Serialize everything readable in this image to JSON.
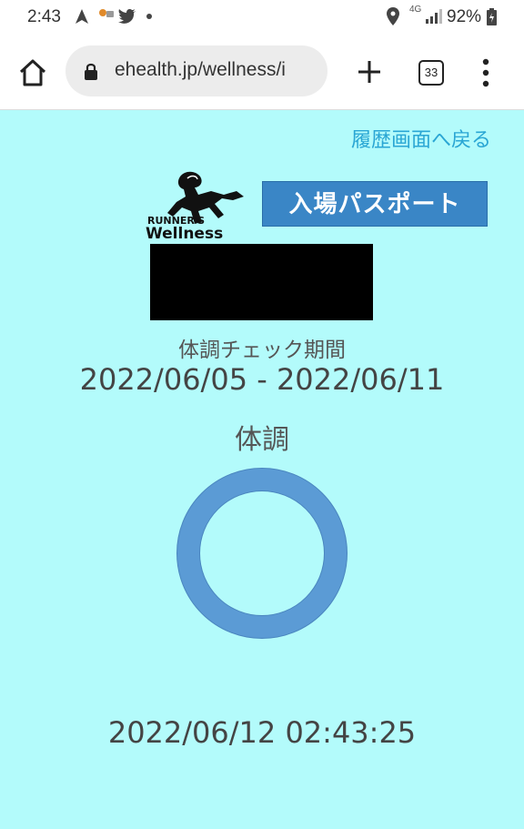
{
  "status_bar": {
    "time": "2:43",
    "network": "4G",
    "battery": "92%",
    "icons": [
      "navigation-icon",
      "notification-icon",
      "twitter-icon",
      "location-icon",
      "signal-icon",
      "battery-icon"
    ]
  },
  "browser": {
    "url": "ehealth.jp/wellness/i",
    "tab_count": "33"
  },
  "page": {
    "back_link": "履歴画面へ戻る",
    "logo": {
      "line1": "RUNNER'S",
      "line2": "Wellness"
    },
    "passport_label": "入場パスポート",
    "period_label": "体調チェック期間",
    "period_range": "2022/06/05 - 2022/06/11",
    "condition_label": "体調",
    "condition_mark": "circle",
    "timestamp": "2022/06/12 02:43:25"
  },
  "colors": {
    "background": "#b3fbfb",
    "link": "#2aa6d4",
    "badge": "#3a86c6",
    "ring": "#5b9bd5",
    "redaction": "#000000"
  }
}
